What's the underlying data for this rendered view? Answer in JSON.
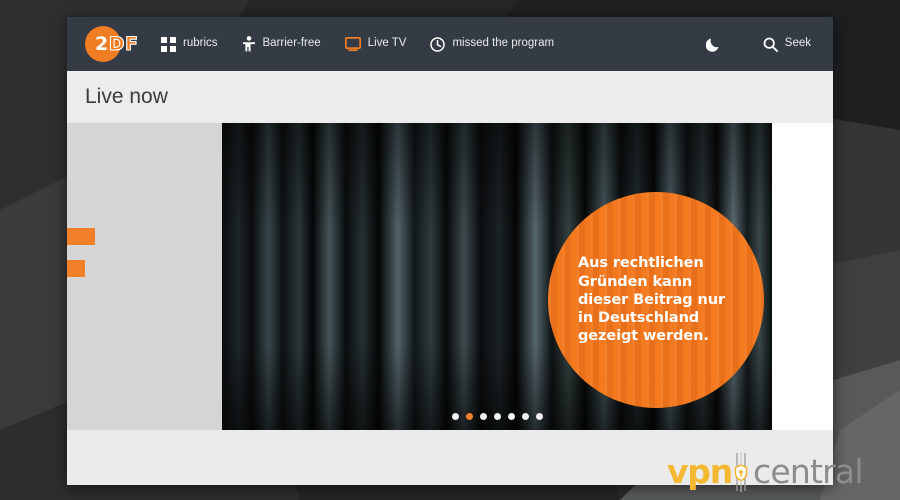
{
  "site": {
    "brand": {
      "name": "ZDF",
      "mark_white": "2",
      "mark_orange": "DF",
      "accent": "#f07d23"
    },
    "header_bg": "#353b45",
    "nav_left": [
      {
        "id": "rubrics",
        "label": "rubrics",
        "icon": "grid-icon",
        "icon_color": "#ffffff"
      },
      {
        "id": "barrier",
        "label": "Barrier-free",
        "icon": "accessibility-icon",
        "icon_color": "#ffffff"
      },
      {
        "id": "live-tv",
        "label": "Live TV",
        "icon": "monitor-icon",
        "icon_color": "#f07d23"
      },
      {
        "id": "missed",
        "label": "missed the program",
        "icon": "clock-icon",
        "icon_color": "#ffffff"
      }
    ],
    "nav_right": [
      {
        "id": "darkmode",
        "label": "",
        "icon": "moon-icon",
        "icon_color": "#ffffff"
      },
      {
        "id": "search",
        "label": "Seek",
        "icon": "search-icon",
        "icon_color": "#ffffff"
      }
    ]
  },
  "main": {
    "page_title": "Live now",
    "band_bg": "#ececec"
  },
  "stage": {
    "rail_bg": "#d5d5d5",
    "markers": [
      {
        "id": "marker-1",
        "color": "#f2802a"
      },
      {
        "id": "marker-2",
        "color": "#f2802a"
      }
    ],
    "geo_block": {
      "message": "Aus rechtlichen Gründen kann dieser Beitrag nur in Deutschland gezeigt werden.",
      "lines": [
        "Aus rechtlichen",
        "Gründen kann",
        "dieser Beitrag nur",
        "in Deutschland",
        "gezeigt werden."
      ],
      "badge_color": "#f4761b",
      "text_color": "#ffffff"
    },
    "carousel": {
      "total": 7,
      "active_index": 1,
      "active_color": "#f2802a",
      "inactive_color": "#f2f2f2"
    }
  },
  "watermark": {
    "part_one": "vpn",
    "part_two": "central",
    "part_one_color": "#f5b833",
    "part_two_color": "#8d8d8d",
    "icon": "shield-icon"
  }
}
